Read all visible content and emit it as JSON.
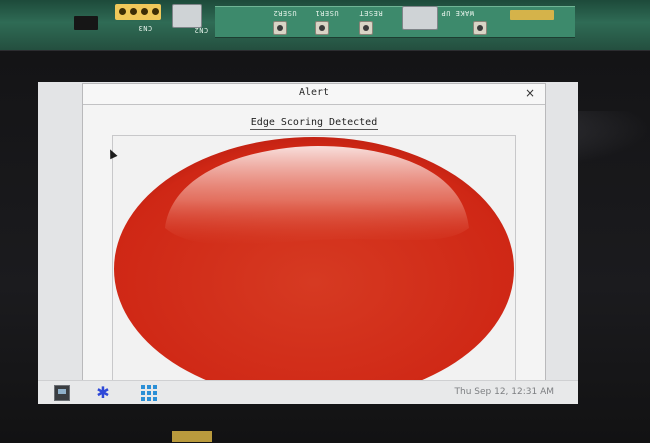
{
  "dialog": {
    "title": "Alert",
    "close_glyph": "×",
    "message": "Edge Scoring Detected",
    "alert_indicator": {
      "icon": "red-alert-circle-icon",
      "color": "#d42a1a"
    }
  },
  "taskbar": {
    "launchers": [
      {
        "icon": "terminal-icon"
      },
      {
        "icon": "asterisk-settings-icon",
        "glyph": "✱"
      },
      {
        "icon": "app-grid-icon"
      }
    ],
    "clock": "Thu Sep 12, 12:31 AM"
  },
  "board": {
    "silkscreen": [
      "USER2",
      "USER1",
      "RESET",
      "WAKE UP",
      "CN2",
      "CN3"
    ]
  }
}
